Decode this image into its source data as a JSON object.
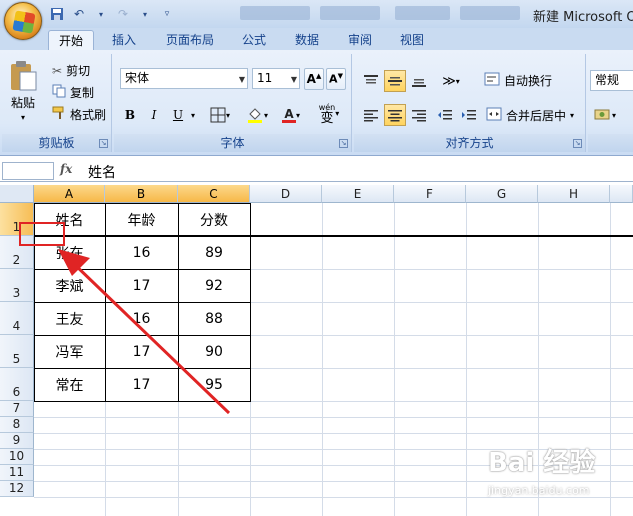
{
  "window": {
    "title": "新建 Microsoft O"
  },
  "tabs": [
    {
      "label": "开始",
      "active": true
    },
    {
      "label": "插入"
    },
    {
      "label": "页面布局"
    },
    {
      "label": "公式"
    },
    {
      "label": "数据"
    },
    {
      "label": "审阅"
    },
    {
      "label": "视图"
    }
  ],
  "ribbon": {
    "clipboard": {
      "label": "剪贴板",
      "paste": "粘贴",
      "cut": "剪切",
      "copy": "复制",
      "format_painter": "格式刷"
    },
    "font": {
      "label": "字体",
      "font_name": "宋体",
      "font_size": "11",
      "bold": "B",
      "italic": "I",
      "underline": "U",
      "font_color_glyph": "A",
      "phonetic_glyph": "wén",
      "phonetic_char": "变"
    },
    "alignment": {
      "label": "对齐方式",
      "wrap_text": "自动换行",
      "merge_center": "合并后居中"
    },
    "number": {
      "format": "常规"
    }
  },
  "formula_bar": {
    "fx": "fx",
    "content": "姓名"
  },
  "columns": [
    "A",
    "B",
    "C",
    "D",
    "E",
    "F",
    "G",
    "H"
  ],
  "rows": [
    "1",
    "2",
    "3",
    "4",
    "5",
    "6",
    "7",
    "8",
    "9",
    "10",
    "11",
    "12"
  ],
  "table": {
    "header": [
      "姓名",
      "年龄",
      "分数"
    ],
    "rows": [
      [
        "张在",
        "16",
        "89"
      ],
      [
        "李斌",
        "17",
        "92"
      ],
      [
        "王友",
        "16",
        "88"
      ],
      [
        "冯军",
        "17",
        "90"
      ],
      [
        "常在",
        "17",
        "95"
      ]
    ]
  },
  "colors": {
    "annotation_red": "#e02424",
    "ribbon_blue": "#15428b"
  },
  "watermark": {
    "text": "Bai 经验",
    "sub": "jingyan.baidu.com"
  }
}
